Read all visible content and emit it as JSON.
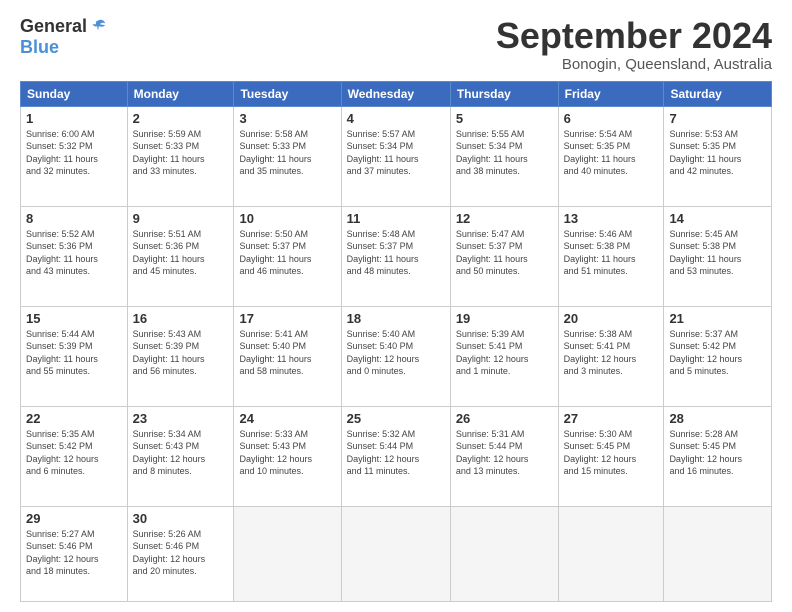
{
  "logo": {
    "general": "General",
    "blue": "Blue"
  },
  "title": "September 2024",
  "subtitle": "Bonogin, Queensland, Australia",
  "days_of_week": [
    "Sunday",
    "Monday",
    "Tuesday",
    "Wednesday",
    "Thursday",
    "Friday",
    "Saturday"
  ],
  "weeks": [
    [
      {
        "day": "1",
        "info": "Sunrise: 6:00 AM\nSunset: 5:32 PM\nDaylight: 11 hours\nand 32 minutes."
      },
      {
        "day": "2",
        "info": "Sunrise: 5:59 AM\nSunset: 5:33 PM\nDaylight: 11 hours\nand 33 minutes."
      },
      {
        "day": "3",
        "info": "Sunrise: 5:58 AM\nSunset: 5:33 PM\nDaylight: 11 hours\nand 35 minutes."
      },
      {
        "day": "4",
        "info": "Sunrise: 5:57 AM\nSunset: 5:34 PM\nDaylight: 11 hours\nand 37 minutes."
      },
      {
        "day": "5",
        "info": "Sunrise: 5:55 AM\nSunset: 5:34 PM\nDaylight: 11 hours\nand 38 minutes."
      },
      {
        "day": "6",
        "info": "Sunrise: 5:54 AM\nSunset: 5:35 PM\nDaylight: 11 hours\nand 40 minutes."
      },
      {
        "day": "7",
        "info": "Sunrise: 5:53 AM\nSunset: 5:35 PM\nDaylight: 11 hours\nand 42 minutes."
      }
    ],
    [
      {
        "day": "8",
        "info": "Sunrise: 5:52 AM\nSunset: 5:36 PM\nDaylight: 11 hours\nand 43 minutes."
      },
      {
        "day": "9",
        "info": "Sunrise: 5:51 AM\nSunset: 5:36 PM\nDaylight: 11 hours\nand 45 minutes."
      },
      {
        "day": "10",
        "info": "Sunrise: 5:50 AM\nSunset: 5:37 PM\nDaylight: 11 hours\nand 46 minutes."
      },
      {
        "day": "11",
        "info": "Sunrise: 5:48 AM\nSunset: 5:37 PM\nDaylight: 11 hours\nand 48 minutes."
      },
      {
        "day": "12",
        "info": "Sunrise: 5:47 AM\nSunset: 5:37 PM\nDaylight: 11 hours\nand 50 minutes."
      },
      {
        "day": "13",
        "info": "Sunrise: 5:46 AM\nSunset: 5:38 PM\nDaylight: 11 hours\nand 51 minutes."
      },
      {
        "day": "14",
        "info": "Sunrise: 5:45 AM\nSunset: 5:38 PM\nDaylight: 11 hours\nand 53 minutes."
      }
    ],
    [
      {
        "day": "15",
        "info": "Sunrise: 5:44 AM\nSunset: 5:39 PM\nDaylight: 11 hours\nand 55 minutes."
      },
      {
        "day": "16",
        "info": "Sunrise: 5:43 AM\nSunset: 5:39 PM\nDaylight: 11 hours\nand 56 minutes."
      },
      {
        "day": "17",
        "info": "Sunrise: 5:41 AM\nSunset: 5:40 PM\nDaylight: 11 hours\nand 58 minutes."
      },
      {
        "day": "18",
        "info": "Sunrise: 5:40 AM\nSunset: 5:40 PM\nDaylight: 12 hours\nand 0 minutes."
      },
      {
        "day": "19",
        "info": "Sunrise: 5:39 AM\nSunset: 5:41 PM\nDaylight: 12 hours\nand 1 minute."
      },
      {
        "day": "20",
        "info": "Sunrise: 5:38 AM\nSunset: 5:41 PM\nDaylight: 12 hours\nand 3 minutes."
      },
      {
        "day": "21",
        "info": "Sunrise: 5:37 AM\nSunset: 5:42 PM\nDaylight: 12 hours\nand 5 minutes."
      }
    ],
    [
      {
        "day": "22",
        "info": "Sunrise: 5:35 AM\nSunset: 5:42 PM\nDaylight: 12 hours\nand 6 minutes."
      },
      {
        "day": "23",
        "info": "Sunrise: 5:34 AM\nSunset: 5:43 PM\nDaylight: 12 hours\nand 8 minutes."
      },
      {
        "day": "24",
        "info": "Sunrise: 5:33 AM\nSunset: 5:43 PM\nDaylight: 12 hours\nand 10 minutes."
      },
      {
        "day": "25",
        "info": "Sunrise: 5:32 AM\nSunset: 5:44 PM\nDaylight: 12 hours\nand 11 minutes."
      },
      {
        "day": "26",
        "info": "Sunrise: 5:31 AM\nSunset: 5:44 PM\nDaylight: 12 hours\nand 13 minutes."
      },
      {
        "day": "27",
        "info": "Sunrise: 5:30 AM\nSunset: 5:45 PM\nDaylight: 12 hours\nand 15 minutes."
      },
      {
        "day": "28",
        "info": "Sunrise: 5:28 AM\nSunset: 5:45 PM\nDaylight: 12 hours\nand 16 minutes."
      }
    ],
    [
      {
        "day": "29",
        "info": "Sunrise: 5:27 AM\nSunset: 5:46 PM\nDaylight: 12 hours\nand 18 minutes."
      },
      {
        "day": "30",
        "info": "Sunrise: 5:26 AM\nSunset: 5:46 PM\nDaylight: 12 hours\nand 20 minutes."
      },
      null,
      null,
      null,
      null,
      null
    ]
  ]
}
